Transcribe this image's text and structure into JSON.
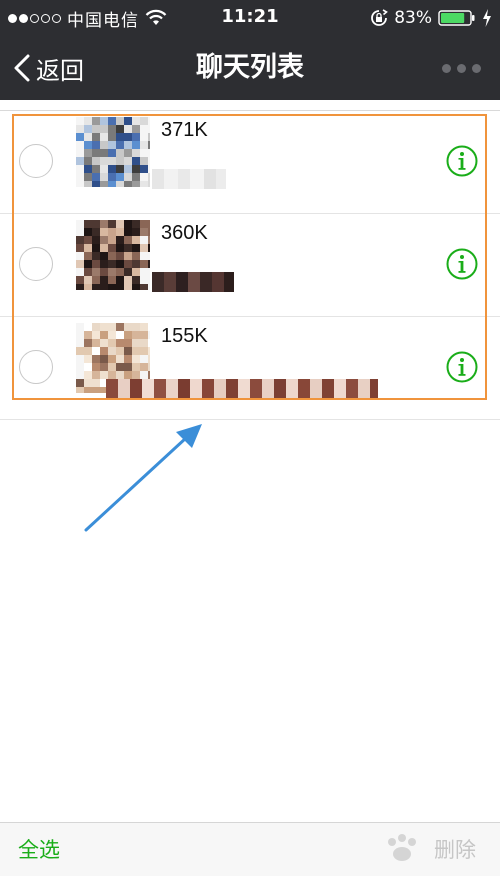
{
  "status_bar": {
    "carrier": "中国电信",
    "time": "11:21",
    "battery_percent": "83%",
    "battery_level": 0.83,
    "icons": [
      "signal-dots-icon",
      "wifi-icon",
      "rotation-lock-icon",
      "battery-icon",
      "charging-bolt-icon"
    ]
  },
  "nav": {
    "back_label": "返回",
    "title": "聊天列表",
    "more_icon": "more-dots-icon"
  },
  "chats": [
    {
      "size": "371K",
      "icon": "info-icon"
    },
    {
      "size": "360K",
      "icon": "info-icon"
    },
    {
      "size": "155K",
      "icon": "info-icon"
    }
  ],
  "bottom_bar": {
    "select_all_label": "全选",
    "delete_label": "删除"
  },
  "colors": {
    "nav_bg": "#2d2e32",
    "accent_green": "#1aad19",
    "highlight_orange": "#f0943c",
    "arrow_blue": "#3b8ed8"
  }
}
